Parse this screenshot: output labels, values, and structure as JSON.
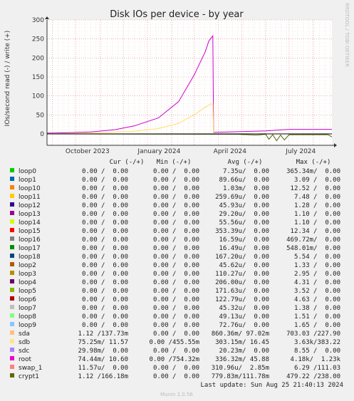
{
  "chart_data": {
    "type": "line",
    "title": "Disk IOs per device - by year",
    "ylabel": "IOs/second read (-) / write (+)",
    "ylim": [
      -30,
      300
    ],
    "yticks": [
      "0",
      "50",
      "100",
      "150",
      "200",
      "250",
      "300"
    ],
    "xticks": [
      "October 2023",
      "January 2024",
      "April 2024",
      "July 2024"
    ],
    "x_start": "2023-08-25",
    "x_end": "2024-08-25",
    "grid": true,
    "side_label": "RRDTOOL / TOBI OETIKER",
    "series": [
      {
        "name": "root",
        "color": "#cc00cc",
        "x": [
          "2023-08-25",
          "2023-09-20",
          "2023-10-20",
          "2023-11-20",
          "2023-12-15",
          "2024-01-15",
          "2024-02-10",
          "2024-03-01",
          "2024-03-15",
          "2024-03-20",
          "2024-03-25",
          "2024-03-26",
          "2024-04-15",
          "2024-06-01",
          "2024-07-01",
          "2024-08-25"
        ],
        "y": [
          2,
          3,
          5,
          11,
          21,
          42,
          85,
          155,
          215,
          245,
          258,
          4,
          5,
          8,
          12,
          12
        ]
      },
      {
        "name": "sdb",
        "color": "#ffe066",
        "x": [
          "2023-08-25",
          "2023-10-20",
          "2023-12-15",
          "2024-01-15",
          "2024-02-10",
          "2024-03-01",
          "2024-03-15",
          "2024-03-20",
          "2024-03-25",
          "2024-03-26",
          "2024-08-25"
        ],
        "y": [
          0,
          2,
          7,
          14,
          28,
          50,
          70,
          76,
          80,
          0,
          0
        ]
      },
      {
        "name": "crypt1",
        "color": "#4d6600",
        "x": [
          "2023-08-25",
          "2024-04-25",
          "2024-05-20",
          "2024-06-01",
          "2024-06-05",
          "2024-06-10",
          "2024-06-15",
          "2024-06-20",
          "2024-06-25",
          "2024-07-01",
          "2024-08-20",
          "2024-08-25"
        ],
        "y": [
          0,
          -1,
          -3,
          -1,
          -14,
          -2,
          -18,
          -3,
          -16,
          -2,
          -2,
          -8
        ]
      }
    ],
    "table": {
      "headers": [
        "Cur (-/+)",
        "Min (-/+)",
        "Avg (-/+)",
        "Max (-/+)"
      ],
      "rows": [
        {
          "name": "loop0",
          "color": "#00cc00",
          "cur": "0.00 /  0.00",
          "min": "0.00 /  0.00",
          "avg": "7.35u/  0.00",
          "max": "365.34m/  0.00"
        },
        {
          "name": "loop1",
          "color": "#0066b3",
          "cur": "0.00 /  0.00",
          "min": "0.00 /  0.00",
          "avg": "89.66u/  0.00",
          "max": "3.09 /  0.00"
        },
        {
          "name": "loop10",
          "color": "#ff8000",
          "cur": "0.00 /  0.00",
          "min": "0.00 /  0.00",
          "avg": "1.03m/  0.00",
          "max": "12.52 /  0.00"
        },
        {
          "name": "loop11",
          "color": "#ffcc00",
          "cur": "0.00 /  0.00",
          "min": "0.00 /  0.00",
          "avg": "259.69u/  0.00",
          "max": "7.48 /  0.00"
        },
        {
          "name": "loop12",
          "color": "#330099",
          "cur": "0.00 /  0.00",
          "min": "0.00 /  0.00",
          "avg": "45.93u/  0.00",
          "max": "1.28 /  0.00"
        },
        {
          "name": "loop13",
          "color": "#990099",
          "cur": "0.00 /  0.00",
          "min": "0.00 /  0.00",
          "avg": "29.20u/  0.00",
          "max": "1.10 /  0.00"
        },
        {
          "name": "loop14",
          "color": "#ccff00",
          "cur": "0.00 /  0.00",
          "min": "0.00 /  0.00",
          "avg": "55.56u/  0.00",
          "max": "1.10 /  0.00"
        },
        {
          "name": "loop15",
          "color": "#ff0000",
          "cur": "0.00 /  0.00",
          "min": "0.00 /  0.00",
          "avg": "353.39u/  0.00",
          "max": "12.34 /  0.00"
        },
        {
          "name": "loop16",
          "color": "#808080",
          "cur": "0.00 /  0.00",
          "min": "0.00 /  0.00",
          "avg": "16.59u/  0.00",
          "max": "469.72m/  0.00"
        },
        {
          "name": "loop17",
          "color": "#008f00",
          "cur": "0.00 /  0.00",
          "min": "0.00 /  0.00",
          "avg": "16.49u/  0.00",
          "max": "548.01m/  0.00"
        },
        {
          "name": "loop18",
          "color": "#00487d",
          "cur": "0.00 /  0.00",
          "min": "0.00 /  0.00",
          "avg": "167.20u/  0.00",
          "max": "5.54 /  0.00"
        },
        {
          "name": "loop2",
          "color": "#b35a00",
          "cur": "0.00 /  0.00",
          "min": "0.00 /  0.00",
          "avg": "45.62u/  0.00",
          "max": "1.33 /  0.00"
        },
        {
          "name": "loop3",
          "color": "#b38f00",
          "cur": "0.00 /  0.00",
          "min": "0.00 /  0.00",
          "avg": "110.27u/  0.00",
          "max": "2.95 /  0.00"
        },
        {
          "name": "loop4",
          "color": "#6b006b",
          "cur": "0.00 /  0.00",
          "min": "0.00 /  0.00",
          "avg": "206.00u/  0.00",
          "max": "4.31 /  0.00"
        },
        {
          "name": "loop5",
          "color": "#8fb300",
          "cur": "0.00 /  0.00",
          "min": "0.00 /  0.00",
          "avg": "171.63u/  0.00",
          "max": "3.52 /  0.00"
        },
        {
          "name": "loop6",
          "color": "#b30000",
          "cur": "0.00 /  0.00",
          "min": "0.00 /  0.00",
          "avg": "122.79u/  0.00",
          "max": "4.63 /  0.00"
        },
        {
          "name": "loop7",
          "color": "#bebebe",
          "cur": "0.00 /  0.00",
          "min": "0.00 /  0.00",
          "avg": "45.32u/  0.00",
          "max": "1.38 /  0.00"
        },
        {
          "name": "loop8",
          "color": "#80ff80",
          "cur": "0.00 /  0.00",
          "min": "0.00 /  0.00",
          "avg": "49.13u/  0.00",
          "max": "1.51 /  0.00"
        },
        {
          "name": "loop9",
          "color": "#80c9ff",
          "cur": "0.00 /  0.00",
          "min": "0.00 /  0.00",
          "avg": "72.76u/  0.00",
          "max": "1.65 /  0.00"
        },
        {
          "name": "sda",
          "color": "#ffc080",
          "cur": "1.12 /137.73m",
          "min": "0.00 /  0.00",
          "avg": "860.36m/ 97.02m",
          "max": "703.03 /227.90"
        },
        {
          "name": "sdb",
          "color": "#ffe680",
          "cur": "75.25m/ 11.57",
          "min": "0.00 /455.55m",
          "avg": "303.15m/ 16.45",
          "max": "3.63k/383.22"
        },
        {
          "name": "sdc",
          "color": "#aa80ff",
          "cur": "29.98m/  0.00",
          "min": "0.00 /  0.00",
          "avg": "20.23m/  0.00",
          "max": "8.55 /  0.00"
        },
        {
          "name": "root",
          "color": "#ee00cc",
          "cur": "74.44m/ 10.60",
          "min": "0.00 /754.32m",
          "avg": "336.32m/ 45.88",
          "max": "4.18k/  1.23k"
        },
        {
          "name": "swap_1",
          "color": "#ff8080",
          "cur": "11.57u/  0.00",
          "min": "0.00 /  0.00",
          "avg": "310.96u/  2.85m",
          "max": "6.29 /111.03"
        },
        {
          "name": "crypt1",
          "color": "#666600",
          "cur": "1.12 /166.18m",
          "min": "0.00 /  0.00",
          "avg": "779.83m/111.78m",
          "max": "479.22 /238.00"
        }
      ]
    },
    "last_update": "Last update: Sun Aug 25 21:40:13 2024",
    "footer": "Munin 2.0.56"
  }
}
